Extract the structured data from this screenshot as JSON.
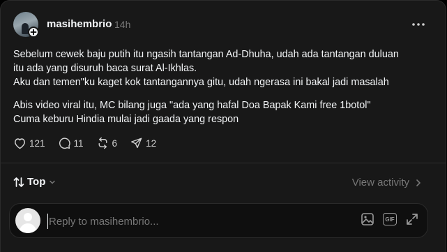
{
  "post": {
    "username": "masihembrio",
    "time": "14h",
    "paragraph1": [
      "Sebelum cewek baju putih itu ngasih tantangan Ad-Dhuha, udah ada tantangan duluan",
      "itu ada yang disuruh baca surat Al-Ikhlas.",
      "Aku dan temen\"ku kaget kok tantangannya gitu, udah ngerasa ini bakal jadi masalah"
    ],
    "paragraph2": [
      "Abis video viral itu, MC bilang juga \"ada yang hafal Doa Bapak Kami free 1botol\"",
      "Cuma keburu Hindia mulai jadi gaada yang respon"
    ],
    "likes": "121",
    "replies": "11",
    "reposts": "6",
    "shares": "12"
  },
  "sort": {
    "label": "Top"
  },
  "view_activity": "View activity",
  "reply": {
    "placeholder": "Reply to masihembrio..."
  },
  "icons": {
    "more": "more-horizontal-icon",
    "like": "heart-icon",
    "reply": "comment-icon",
    "repost": "repost-icon",
    "share": "send-icon",
    "sort": "sort-arrows-icon",
    "image": "image-icon",
    "gif": "gif-icon",
    "expand": "expand-icon"
  }
}
